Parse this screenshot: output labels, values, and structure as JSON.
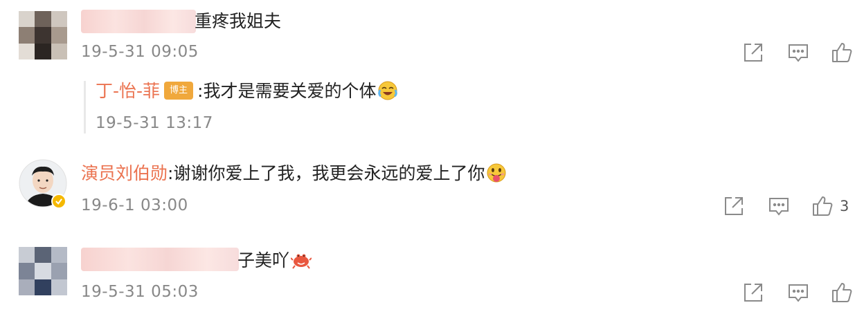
{
  "comments": [
    {
      "text_visible": "重疼我姐夫",
      "time": "19-5-31 09:05",
      "reply": {
        "author": "丁-怡-菲",
        "badge": "博主",
        "text": ":我才是需要关爱的个体",
        "emoji": "laughing-crying-emoji",
        "time": "19-5-31 13:17"
      }
    },
    {
      "author": "演员刘伯勋",
      "text": ":谢谢你爱上了我，我更会永远的爱上了你",
      "emoji": "tongue-out-emoji",
      "time": "19-6-1 03:00",
      "like_count": "3",
      "verified_color": "#f5b800"
    },
    {
      "text_visible": "子美吖",
      "emoji": "crab-emoji",
      "time": "19-5-31 05:03"
    }
  ],
  "icons": {
    "share": "share-icon",
    "comment": "comment-icon",
    "like": "thumbs-up-icon"
  },
  "colors": {
    "name_link": "#eb7350",
    "timestamp": "#888888",
    "icon": "#8a8a8a"
  }
}
